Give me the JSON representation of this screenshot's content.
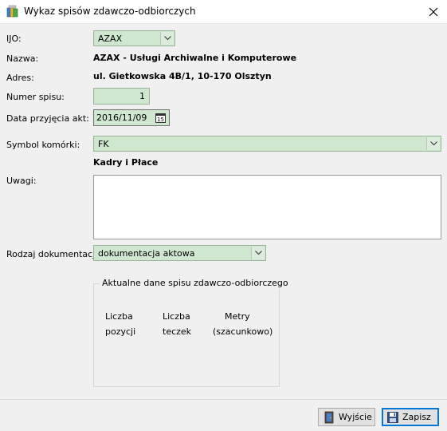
{
  "window": {
    "title": "Wykaz spisów zdawczo-odbiorczych"
  },
  "form": {
    "ijo_label": "IJO:",
    "ijo_value": "AZAX",
    "nazwa_label": "Nazwa:",
    "nazwa_value": "AZAX - Usługi Archiwalne i Komputerowe",
    "adres_label": "Adres:",
    "adres_value": "ul. Gietkowska 4B/1, 10-170 Olsztyn",
    "numer_label": "Numer spisu:",
    "numer_value": "1",
    "data_label": "Data przyjęcia akt:",
    "data_value": "2016/11/09",
    "calendar_glyph": "15",
    "symbol_label": "Symbol komórki:",
    "symbol_value": "FK",
    "symbol_name": "Kadry i Płace",
    "uwagi_label": "Uwagi:",
    "uwagi_value": "",
    "rodzaj_label": "Rodzaj dokumentacji:",
    "rodzaj_value": "dokumentacja aktowa"
  },
  "summary": {
    "title": "Aktualne dane spisu zdawczo-odbiorczego",
    "col1_line1": "Liczba",
    "col1_line2": "pozycji",
    "col2_line1": "Liczba",
    "col2_line2": "teczek",
    "col3_line1": "Metry",
    "col3_line2": "(szacunkowo)"
  },
  "buttons": {
    "exit_label": "Wyjście",
    "save_label": "Zapisz"
  },
  "colors": {
    "field_green": "#cfe7cf",
    "window_bg": "#f0f0f0",
    "primary_border": "#0078d7"
  }
}
